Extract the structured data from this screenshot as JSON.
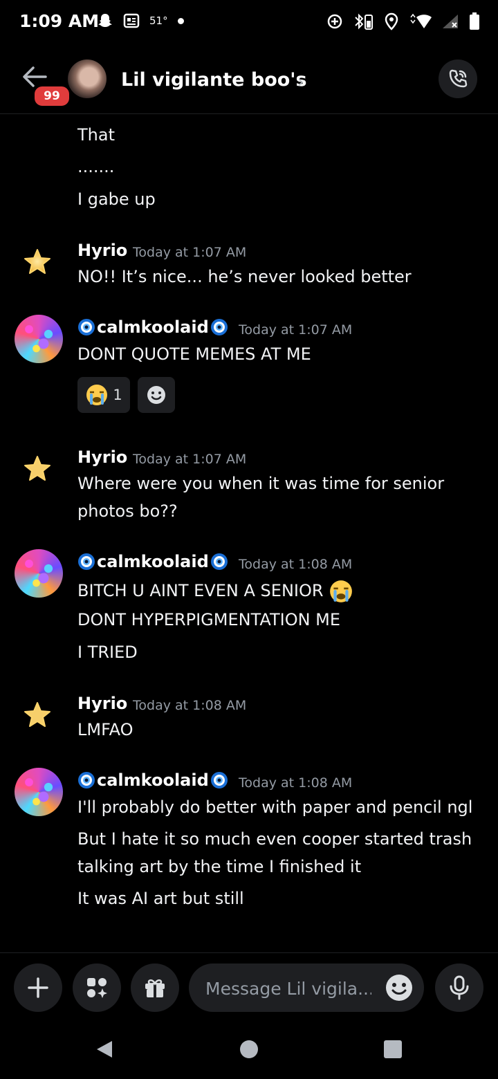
{
  "status_bar": {
    "time": "1:09 AM",
    "temperature": "51°"
  },
  "header": {
    "unread_badge": "99",
    "channel_title": "Lil vigilante boo's",
    "chevron": "›"
  },
  "messages": {
    "m0": {
      "lines": [
        "That",
        ".......",
        "I gabe up"
      ]
    },
    "m1": {
      "author": "Hyrio",
      "timestamp": "Today at 1:07 AM",
      "lines": [
        "NO!! It’s nice... he’s never looked better"
      ]
    },
    "m2": {
      "author": "calmkoolaid",
      "timestamp": "Today at 1:07 AM",
      "lines": [
        "DONT QUOTE MEMES AT ME"
      ],
      "reaction_count": "1"
    },
    "m3": {
      "author": "Hyrio",
      "timestamp": "Today at 1:07 AM",
      "lines": [
        "Where were you when it was time for senior",
        "photos bo??"
      ]
    },
    "m4": {
      "author": "calmkoolaid",
      "timestamp": "Today at 1:08 AM",
      "lines": [
        "BITCH U AINT EVEN A SENIOR",
        "DONT HYPERPIGMENTATION ME",
        "I TRIED"
      ]
    },
    "m5": {
      "author": "Hyrio",
      "timestamp": "Today at 1:08 AM",
      "lines": [
        "LMFAO"
      ]
    },
    "m6": {
      "author": "calmkoolaid",
      "timestamp": "Today at 1:08 AM",
      "lines": [
        "I'll probably do better with paper and pencil ngl",
        "But I hate it so much even cooper started trash",
        "talking art by the time I finished it",
        "It was AI art but still"
      ]
    }
  },
  "composer": {
    "placeholder": "Message Lil vigila..."
  },
  "colors": {
    "background": "#000000",
    "surface": "#1e1f22",
    "muted": "#949ba4",
    "badge": "#e03c3c"
  }
}
